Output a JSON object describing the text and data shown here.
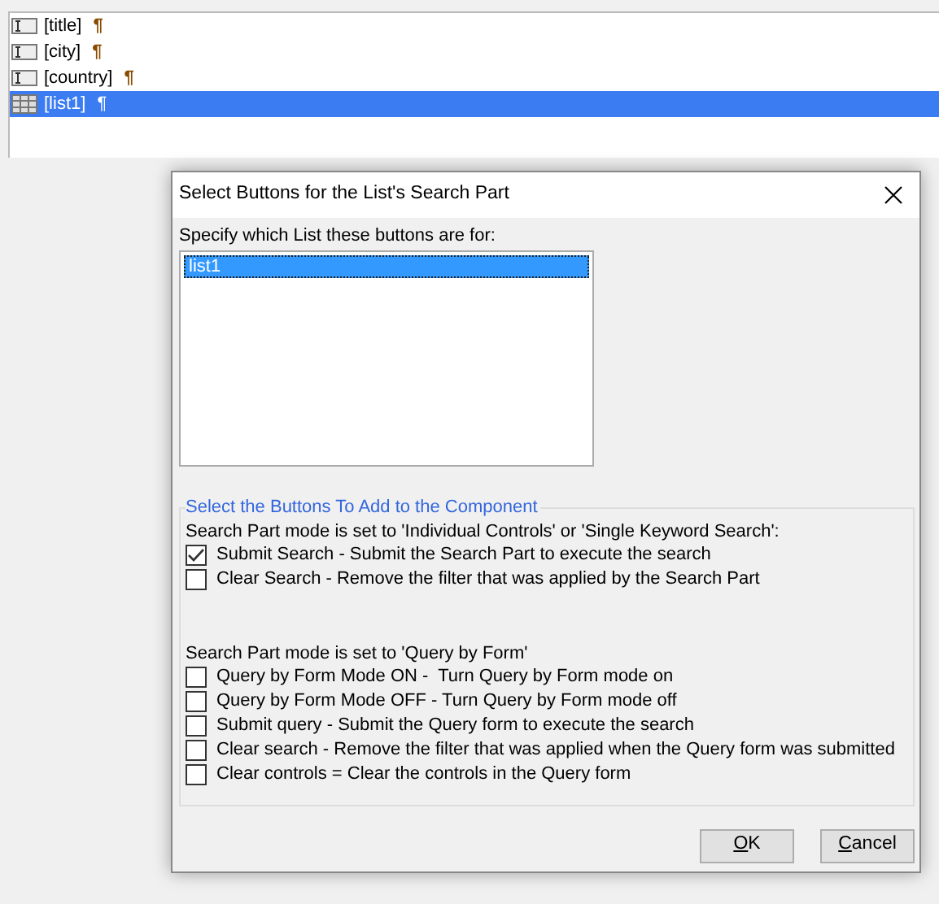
{
  "editor": {
    "rows": [
      {
        "kind": "field",
        "label": "[title]",
        "mark": "¶",
        "selected": false
      },
      {
        "kind": "field",
        "label": "[city]",
        "mark": "¶",
        "selected": false
      },
      {
        "kind": "field",
        "label": "[country]",
        "mark": "¶",
        "selected": false
      },
      {
        "kind": "list",
        "label": "[list1]",
        "mark": "¶",
        "selected": true
      }
    ]
  },
  "dialog": {
    "title": "Select Buttons for the List's Search Part",
    "list_prompt": "Specify which List these buttons are for:",
    "lists": [
      {
        "label": "list1",
        "selected": true
      }
    ],
    "group": {
      "legend": "Select the Buttons To Add to the Component",
      "sections": [
        {
          "heading": "Search Part mode is set to 'Individual Controls' or 'Single Keyword Search':",
          "options": [
            {
              "label": "Submit Search - Submit the Search Part to execute the search",
              "checked": true
            },
            {
              "label": "Clear Search - Remove the filter that was applied by the Search Part",
              "checked": false
            }
          ]
        },
        {
          "heading": "Search Part mode is set to 'Query by Form'",
          "options": [
            {
              "label": "Query by Form Mode ON -  Turn Query by Form mode on",
              "checked": false
            },
            {
              "label": "Query by Form Mode OFF - Turn Query by Form mode off",
              "checked": false
            },
            {
              "label": "Submit query - Submit the Query form to execute the search",
              "checked": false
            },
            {
              "label": "Clear search - Remove the filter that was applied when the Query form was submitted",
              "checked": false
            },
            {
              "label": "Clear controls = Clear the controls in the Query form",
              "checked": false
            }
          ]
        }
      ]
    },
    "buttons": [
      {
        "label": "OK"
      },
      {
        "label": "Cancel"
      }
    ]
  }
}
